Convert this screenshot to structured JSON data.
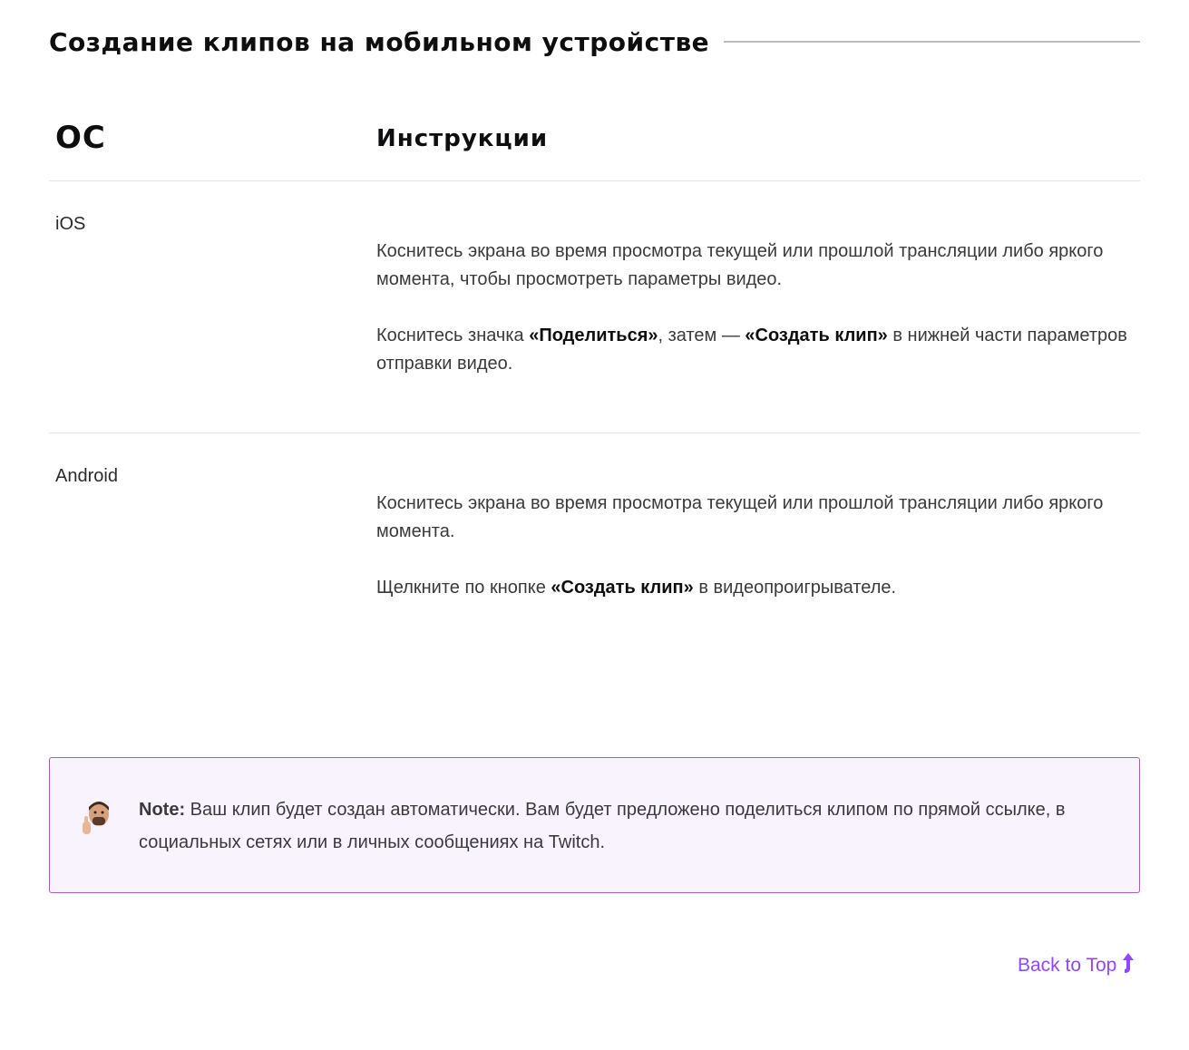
{
  "section": {
    "title": "Создание клипов на мобильном устройстве"
  },
  "table": {
    "headers": {
      "os": "ОС",
      "instructions": "Инструкции"
    },
    "rows": [
      {
        "os": "iOS",
        "p1": "Коснитесь экрана во время просмотра текущей или прошлой трансляции либо яркого момента, чтобы просмотреть параметры видео.",
        "p2_before": "Коснитесь значка ",
        "p2_bold1": "«Поделиться»",
        "p2_mid": ", затем — ",
        "p2_bold2": "«Создать клип»",
        "p2_after": " в нижней части параметров отправки видео."
      },
      {
        "os": "Android",
        "p1": "Коснитесь экрана во время просмотра текущей или прошлой трансляции либо яркого момента.",
        "p2_before": "Щелкните по кнопке ",
        "p2_bold": "«Создать клип»",
        "p2_after": " в видеопроигрывателе."
      }
    ]
  },
  "note": {
    "label": "Note:",
    "text": " Ваш клип будет создан автоматически. Вам будет предложено поделиться клипом по прямой ссылке, в социальных сетях или в личных сообщениях на Twitch.",
    "avatar_icon": "person-thumbs-up-avatar",
    "border_color": "#a35ebc",
    "background": "#f8f3fd"
  },
  "back_to_top": {
    "label": "Back to Top",
    "icon": "arrow-up-icon",
    "color": "#9147ff"
  }
}
